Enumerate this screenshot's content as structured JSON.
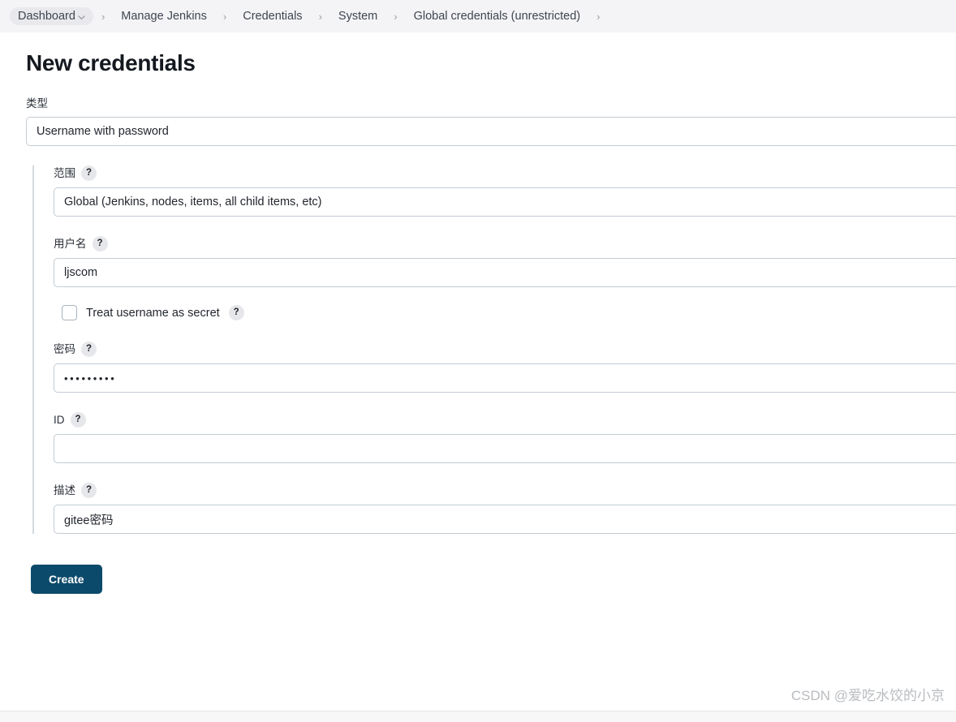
{
  "breadcrumb": {
    "items": [
      {
        "label": "Dashboard",
        "has_dropdown": true
      },
      {
        "label": "Manage Jenkins",
        "has_dropdown": false
      },
      {
        "label": "Credentials",
        "has_dropdown": false
      },
      {
        "label": "System",
        "has_dropdown": false
      },
      {
        "label": "Global credentials (unrestricted)",
        "has_dropdown": false
      }
    ],
    "separator": "›"
  },
  "page": {
    "title": "New credentials"
  },
  "form": {
    "type": {
      "label": "类型",
      "value": "Username with password"
    },
    "scope": {
      "label": "范围",
      "help": "?",
      "value": "Global (Jenkins, nodes, items, all child items, etc)"
    },
    "username": {
      "label": "用户名",
      "help": "?",
      "value": "ljscom"
    },
    "treat_username_as_secret": {
      "label": "Treat username as secret",
      "help": "?",
      "checked": false
    },
    "password": {
      "label": "密码",
      "help": "?",
      "masked_value": "•••••••••"
    },
    "id": {
      "label": "ID",
      "help": "?",
      "value": "",
      "placeholder": ""
    },
    "description": {
      "label": "描述",
      "help": "?",
      "value": "gitee密码"
    }
  },
  "actions": {
    "create_label": "Create"
  },
  "watermark": {
    "text": "CSDN @爱吃水饺的小京"
  },
  "colors": {
    "breadcrumb_bg": "#f4f4f6",
    "button_primary": "#0c4a6b",
    "input_border": "#c3ccd4",
    "rail": "#d4d9de"
  }
}
